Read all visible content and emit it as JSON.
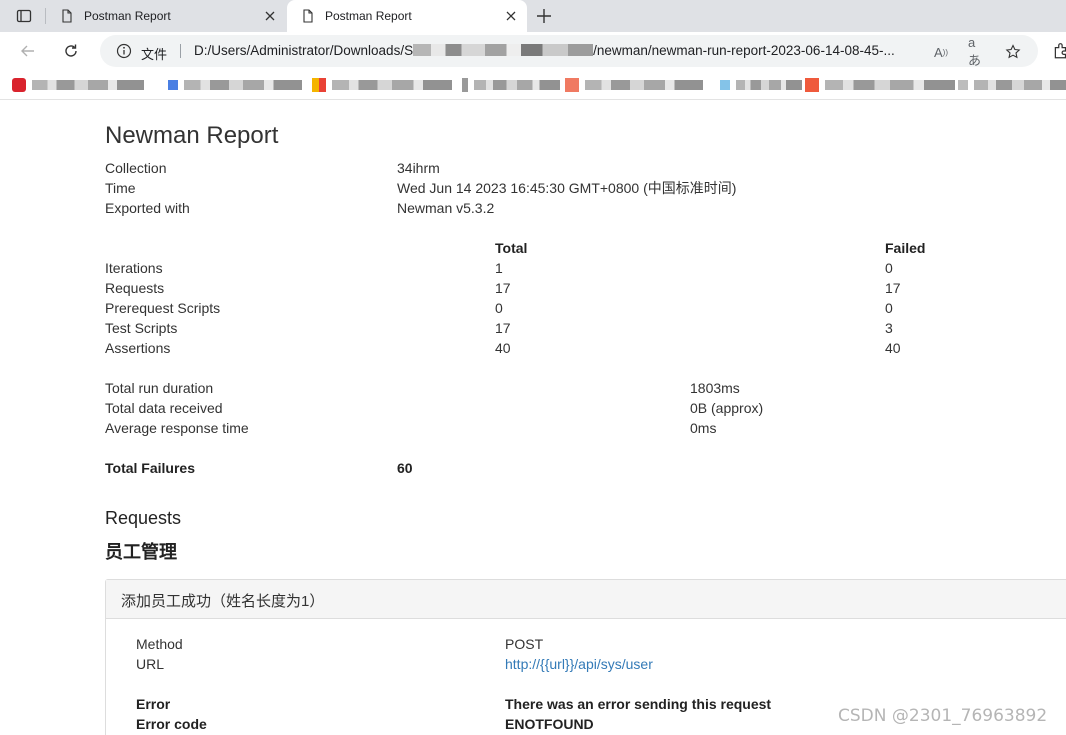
{
  "browser": {
    "tabs": [
      {
        "title": "Postman Report"
      },
      {
        "title": "Postman Report"
      }
    ],
    "address_bar": {
      "security_label": "文件",
      "url_prefix": "D:/Users/Administrator/Downloads/S",
      "url_suffix": "/newman/newman-run-report-2023-06-14-08-45-..."
    }
  },
  "report": {
    "title": "Newman Report",
    "meta": [
      {
        "label": "Collection",
        "value": "34ihrm"
      },
      {
        "label": "Time",
        "value": "Wed Jun 14 2023 16:45:30 GMT+0800 (中国标准时间)"
      },
      {
        "label": "Exported with",
        "value": "Newman v5.3.2"
      }
    ],
    "summary": {
      "headers": {
        "total": "Total",
        "failed": "Failed"
      },
      "rows": [
        {
          "label": "Iterations",
          "total": "1",
          "failed": "0"
        },
        {
          "label": "Requests",
          "total": "17",
          "failed": "17"
        },
        {
          "label": "Prerequest Scripts",
          "total": "0",
          "failed": "0"
        },
        {
          "label": "Test Scripts",
          "total": "17",
          "failed": "3"
        },
        {
          "label": "Assertions",
          "total": "40",
          "failed": "40"
        }
      ]
    },
    "timings": [
      {
        "label": "Total run duration",
        "value": "1803ms"
      },
      {
        "label": "Total data received",
        "value": "0B (approx)"
      },
      {
        "label": "Average response time",
        "value": "0ms"
      }
    ],
    "total_failures": {
      "label": "Total Failures",
      "value": "60"
    },
    "requests_heading": "Requests",
    "folder_name": "员工管理",
    "request": {
      "name": "添加员工成功（姓名长度为1）",
      "method_label": "Method",
      "method": "POST",
      "url_label": "URL",
      "url": "http://{{url}}/api/sys/user",
      "error_label": "Error",
      "error": "There was an error sending this request",
      "error_code_label": "Error code",
      "error_code": "ENOTFOUND"
    }
  },
  "watermark": "CSDN @2301_76963892"
}
